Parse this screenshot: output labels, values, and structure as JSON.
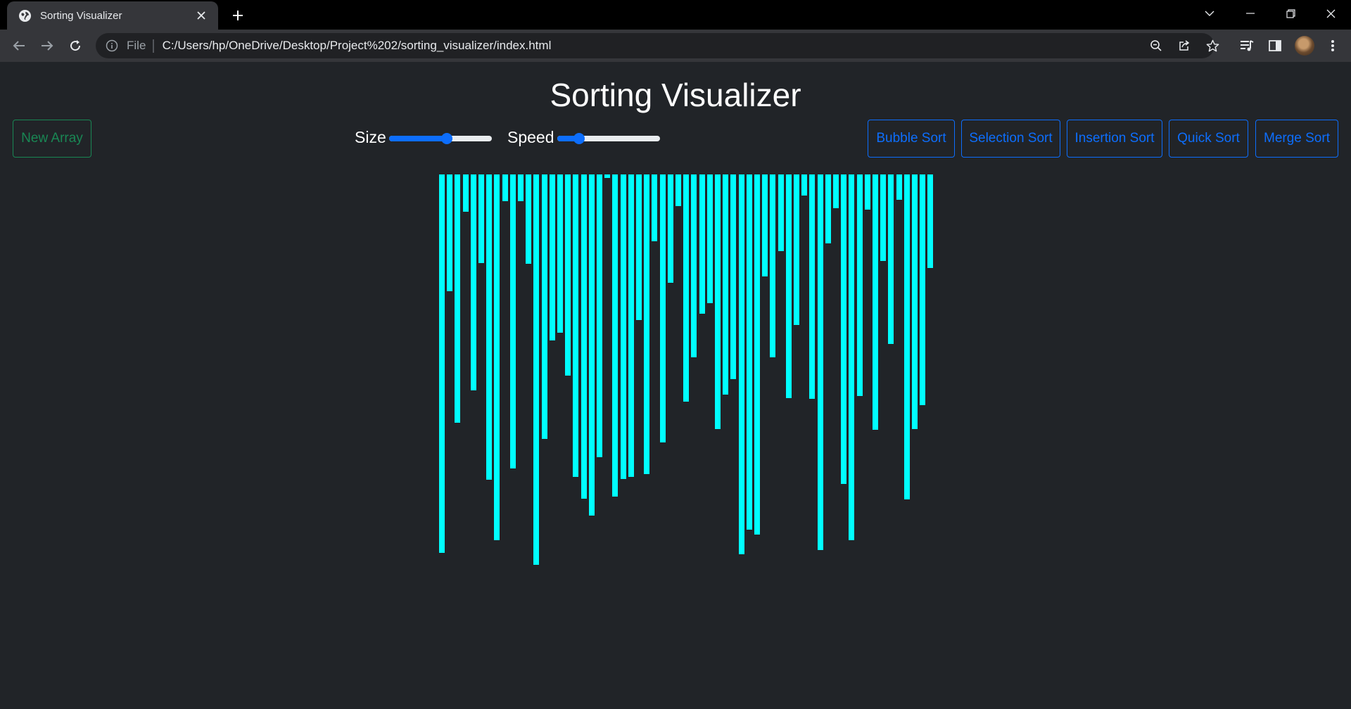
{
  "browser": {
    "tab_title": "Sorting Visualizer",
    "omnibox_scheme": "File",
    "url": "C:/Users/hp/OneDrive/Desktop/Project%202/sorting_visualizer/index.html"
  },
  "page": {
    "title": "Sorting Visualizer",
    "new_array_label": "New Array",
    "size_label": "Size",
    "speed_label": "Speed",
    "size_value": 0.57,
    "speed_value": 0.18,
    "sort_buttons": [
      "Bubble Sort",
      "Selection Sort",
      "Insertion Sort",
      "Quick Sort",
      "Merge Sort"
    ],
    "bar_color": "#00ffff",
    "green_color": "#198754",
    "blue_color": "#0d6efd"
  },
  "chart_data": {
    "type": "bar",
    "values": [
      538,
      166,
      353,
      53,
      307,
      126,
      434,
      520,
      38,
      418,
      38,
      127,
      555,
      376,
      236,
      225,
      286,
      430,
      461,
      485,
      402,
      5,
      458,
      433,
      430,
      207,
      426,
      95,
      381,
      154,
      45,
      323,
      260,
      198,
      183,
      362,
      313,
      291,
      540,
      505,
      512,
      145,
      260,
      109,
      318,
      214,
      30,
      319,
      534,
      98,
      48,
      440,
      520,
      315,
      50,
      363,
      123,
      241,
      36,
      462,
      362,
      328,
      133
    ]
  }
}
